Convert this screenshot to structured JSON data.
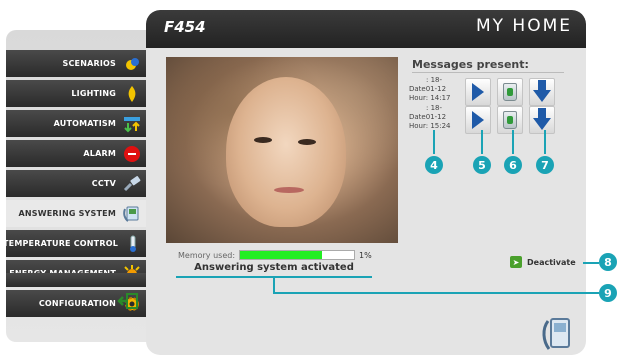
{
  "header": {
    "device_title": "F454",
    "brand": "MY HOME"
  },
  "nav": {
    "items": [
      {
        "label": "SCENARIOS",
        "icon": "scenarios-icon",
        "active": false
      },
      {
        "label": "LIGHTING",
        "icon": "lighting-icon",
        "active": false
      },
      {
        "label": "AUTOMATISM",
        "icon": "automatism-icon",
        "active": false
      },
      {
        "label": "ALARM",
        "icon": "alarm-icon",
        "active": false
      },
      {
        "label": "CCTV",
        "icon": "cctv-icon",
        "active": false
      },
      {
        "label": "ANSWERING SYSTEM",
        "icon": "answering-system-icon",
        "active": true
      },
      {
        "label": "TEMPERATURE CONTROL",
        "icon": "temperature-icon",
        "active": false
      },
      {
        "label": "ENERGY MANAGEMENT",
        "icon": "energy-icon",
        "active": false
      },
      {
        "label": "CONFIGURATION",
        "icon": "configuration-icon",
        "active": false
      }
    ]
  },
  "messages": {
    "title": "Messages present:",
    "list": [
      {
        "line1": ": 18-",
        "line2": "Date01-12",
        "line3": "Hour: 14:17"
      },
      {
        "line1": ": 18-",
        "line2": "Date01-12",
        "line3": "Hour: 15:24"
      }
    ]
  },
  "memory": {
    "label": "Memory used:",
    "percent_label": "1%",
    "fill_fraction": 0.72
  },
  "status": {
    "text": "Answering system activated"
  },
  "deactivate": {
    "label": "Deactivate"
  },
  "callouts": [
    "4",
    "5",
    "6",
    "7",
    "8",
    "9"
  ],
  "colors": {
    "accent": "#1aa3b5",
    "memory_fill": "#22ee22",
    "header_dark": "#2a2a2a"
  }
}
